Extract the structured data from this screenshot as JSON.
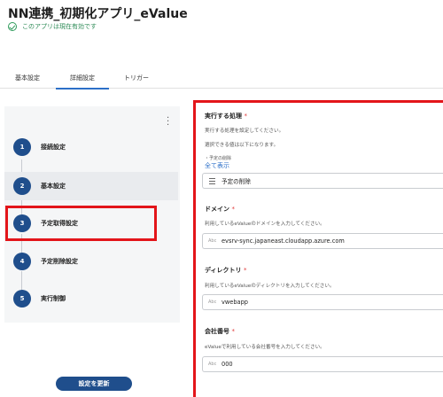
{
  "app": {
    "title": "NN連携_初期化アプリ_eValue",
    "status_text": "このアプリは現在有効です"
  },
  "tabs": [
    {
      "label": "基本設定",
      "active": false
    },
    {
      "label": "詳細設定",
      "active": true
    },
    {
      "label": "トリガー",
      "active": false
    }
  ],
  "steps": [
    {
      "number": "1",
      "label": "接続設定"
    },
    {
      "number": "2",
      "label": "基本設定"
    },
    {
      "number": "3",
      "label": "予定取得設定"
    },
    {
      "number": "4",
      "label": "予定削除設定"
    },
    {
      "number": "5",
      "label": "実行制御"
    }
  ],
  "update_button": "設定を更新",
  "fields": {
    "action": {
      "label": "実行する処理",
      "required_mark": "*",
      "help1": "実行する処理を設定してください。",
      "help2": "選択できる値は以下になります。",
      "caption": "・予定の削除",
      "link": "全て表示",
      "value": "予定の削除"
    },
    "domain": {
      "label": "ドメイン",
      "required_mark": "*",
      "help": "利用しているeValueのドメインを入力してください。",
      "prefix": "Abc",
      "value": "evsrv-sync.japaneast.cloudapp.azure.com"
    },
    "directory": {
      "label": "ディレクトリ",
      "required_mark": "*",
      "help": "利用しているeValueのディレクトリを入力してください。",
      "prefix": "Abc",
      "value": "vwebapp"
    },
    "company": {
      "label": "会社番号",
      "required_mark": "*",
      "help": "eValueで利用している会社番号を入力してください。",
      "prefix": "Abc",
      "value": "000"
    }
  },
  "colors": {
    "accent": "#1f4e8c",
    "highlight": "#e3151a",
    "success": "#2e9b5b",
    "link": "#2c6fc8"
  },
  "icons": [
    "check-circle-icon",
    "kebab-menu-icon",
    "list-icon"
  ]
}
